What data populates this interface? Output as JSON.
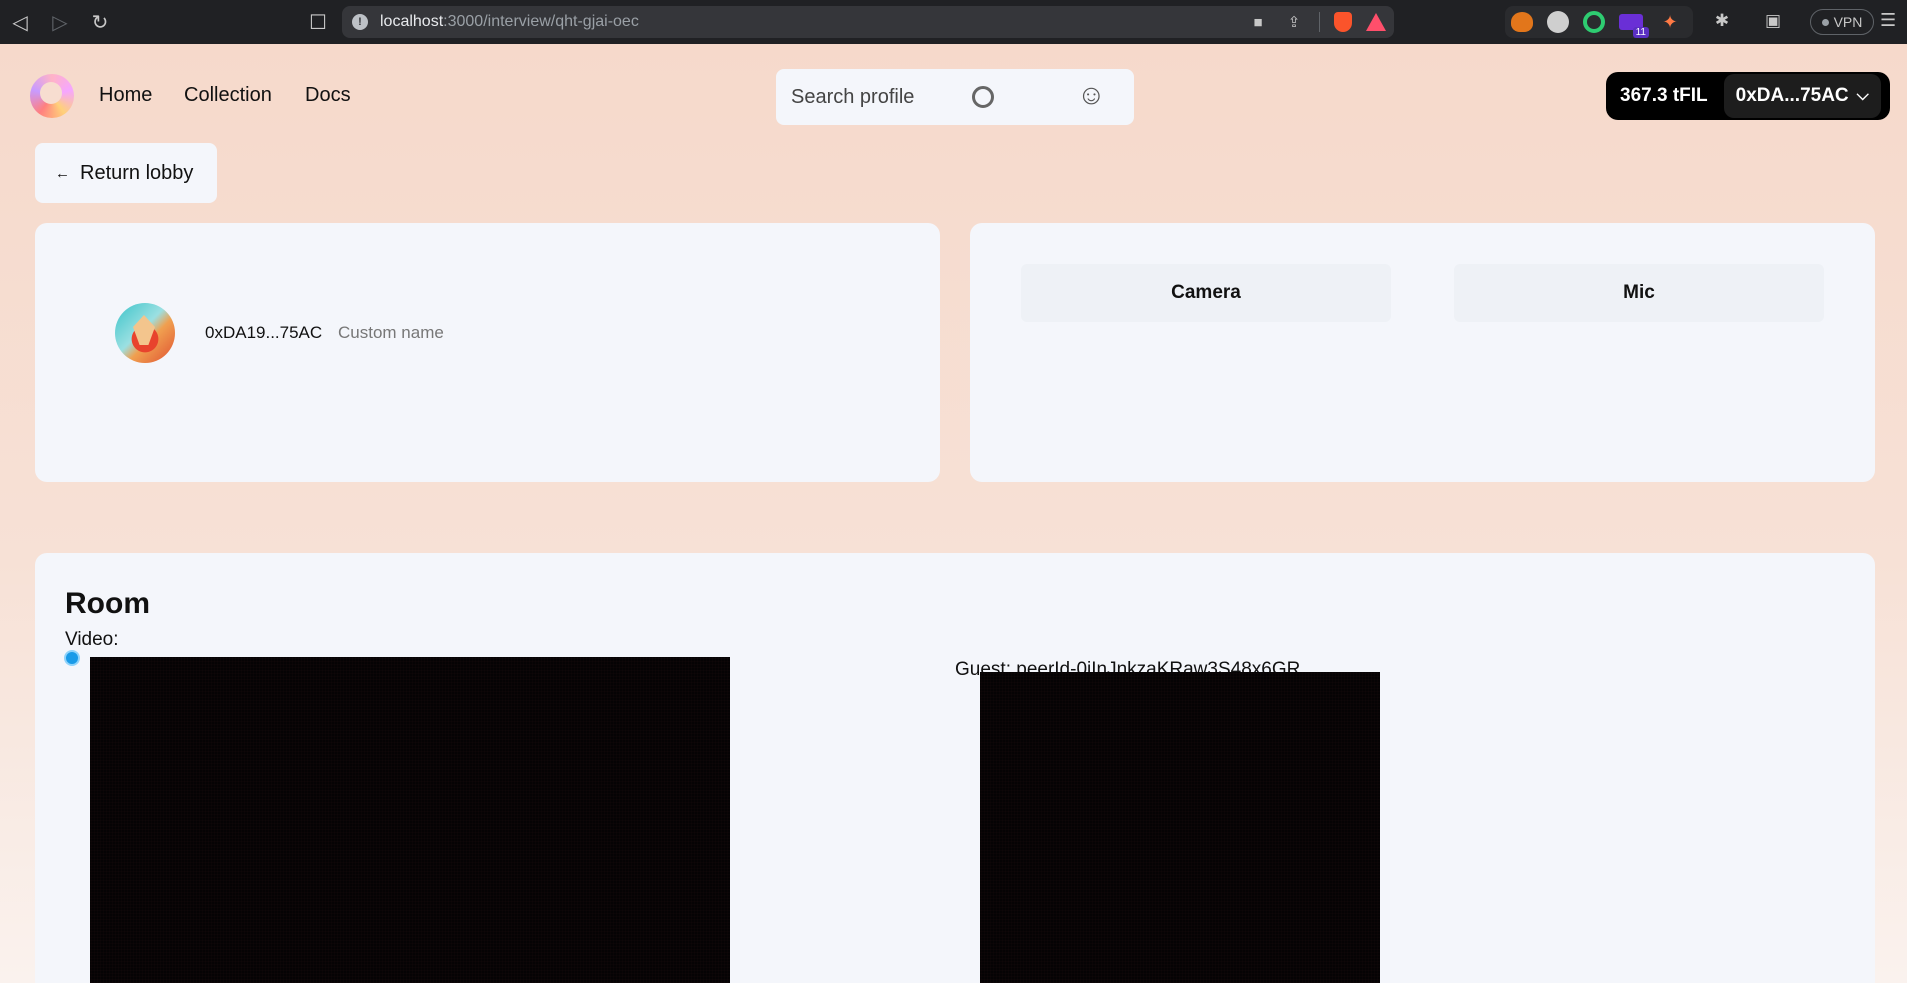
{
  "browser": {
    "url_host": "localhost",
    "url_path": ":3000/interview/qht-gjai-oec",
    "vpn_label": "VPN",
    "extension_badge": "11",
    "icons": {
      "back": "arrow-left-icon",
      "forward": "arrow-right-icon",
      "reload": "reload-icon",
      "bookmark": "bookmark-icon",
      "info": "info-icon",
      "camera": "video-camera-icon",
      "share": "share-icon",
      "brave": "brave-shield-icon",
      "rewards": "rewards-triangle-icon",
      "extensions": "puzzle-icon",
      "wallet": "wallet-icon",
      "menu": "hamburger-menu-icon"
    }
  },
  "nav": {
    "links": [
      "Home",
      "Collection",
      "Docs"
    ],
    "search_placeholder": "Search profile",
    "balance": "367.3 tFIL",
    "account": "0xDA...75AC"
  },
  "return_label": "Return lobby",
  "profile": {
    "address": "0xDA19...75AC",
    "custom_name": "Custom name"
  },
  "devices": {
    "camera_label": "Camera",
    "mic_label": "Mic"
  },
  "room": {
    "title": "Room",
    "video_label": "Video:",
    "guest_label": "Guest: peerId-0iInJnkzaKRaw3S48x6GR"
  },
  "colors": {
    "page_bg": "#f6d9cb",
    "card_bg": "#f4f6fb",
    "wallet_bg": "#000000",
    "record_dot": "#1a9be8"
  }
}
